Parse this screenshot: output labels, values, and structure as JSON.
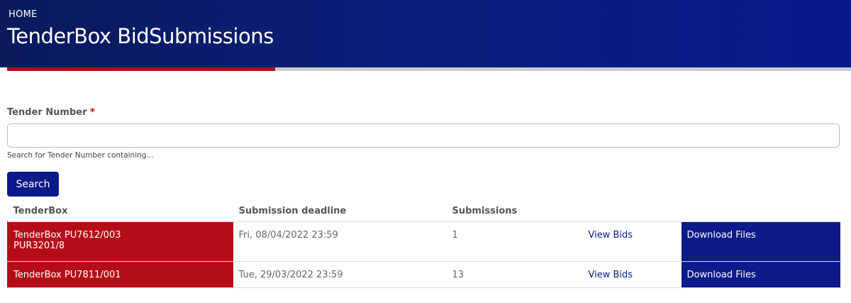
{
  "header": {
    "breadcrumb": "HOME",
    "title": "TenderBox BidSubmissions",
    "gradient_colors": [
      "#0a1a5c",
      "#0a1a8e"
    ],
    "accent_red": "#b40d17"
  },
  "search": {
    "label": "Tender Number",
    "required_marker": "*",
    "value": "",
    "placeholder": "",
    "help_text": "Search for Tender Number containing...",
    "button_label": "Search"
  },
  "table": {
    "columns": [
      "TenderBox",
      "Submission deadline",
      "Submissions",
      "",
      ""
    ],
    "rows": [
      {
        "tender_line1": "TenderBox PU7612/003",
        "tender_line2": "PUR3201/8",
        "deadline": "Fri, 08/04/2022 23:59",
        "submissions": "1",
        "view_label": "View Bids",
        "download_label": "Download Files"
      },
      {
        "tender_line1": "TenderBox PU7811/001",
        "tender_line2": "",
        "deadline": "Tue, 29/03/2022 23:59",
        "submissions": "13",
        "view_label": "View Bids",
        "download_label": "Download Files"
      }
    ]
  },
  "colors": {
    "primary_blue": "#0c1a8a",
    "tender_red": "#b40d17"
  }
}
